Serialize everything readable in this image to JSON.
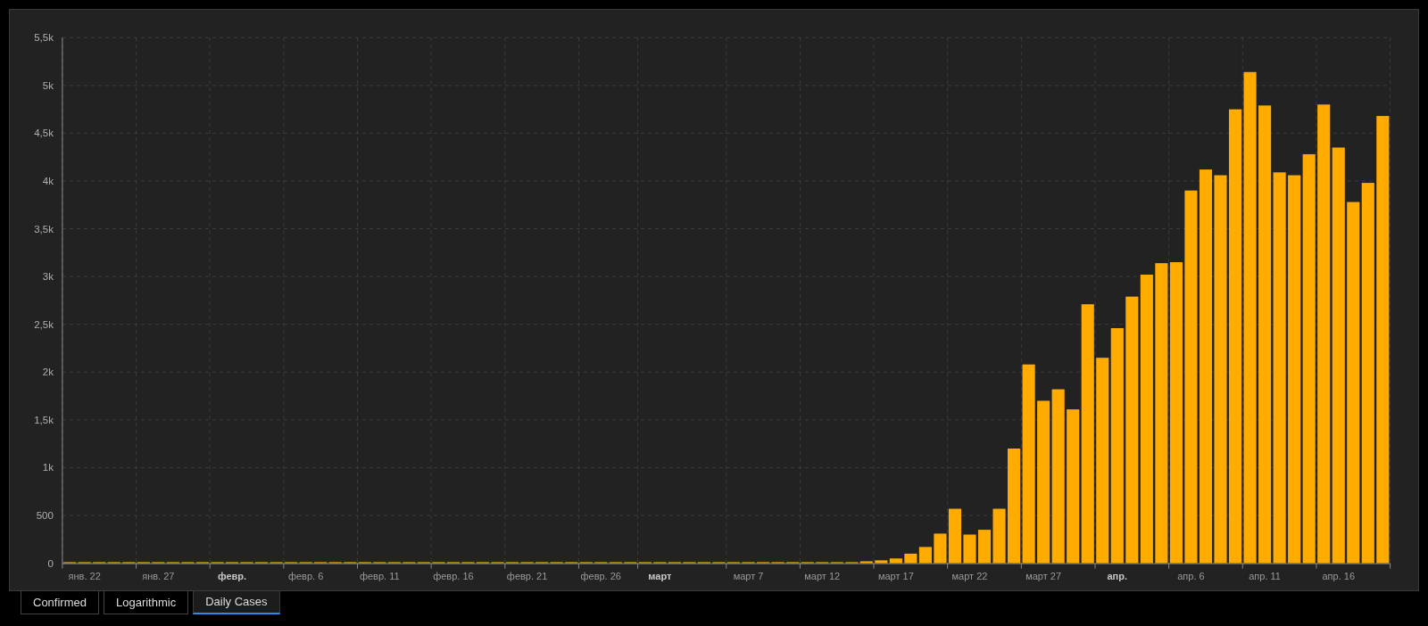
{
  "chart_data": {
    "type": "bar",
    "grid": true,
    "ylim": [
      0,
      5500
    ],
    "yticks": [
      {
        "value": 0,
        "label": "0"
      },
      {
        "value": 500,
        "label": "500"
      },
      {
        "value": 1000,
        "label": "1k"
      },
      {
        "value": 1500,
        "label": "1,5k"
      },
      {
        "value": 2000,
        "label": "2k"
      },
      {
        "value": 2500,
        "label": "2,5k"
      },
      {
        "value": 3000,
        "label": "3k"
      },
      {
        "value": 3500,
        "label": "3,5k"
      },
      {
        "value": 4000,
        "label": "4k"
      },
      {
        "value": 4500,
        "label": "4,5k"
      },
      {
        "value": 5000,
        "label": "5k"
      },
      {
        "value": 5500,
        "label": "5,5k"
      }
    ],
    "categories": [
      null,
      "янв. 22",
      null,
      null,
      null,
      null,
      "янв. 27",
      null,
      null,
      null,
      null,
      "**февр.**",
      null,
      null,
      null,
      null,
      "февр. 6",
      null,
      null,
      null,
      null,
      "февр. 11",
      null,
      null,
      null,
      null,
      "февр. 16",
      null,
      null,
      null,
      null,
      "февр. 21",
      null,
      null,
      null,
      null,
      "февр. 26",
      null,
      null,
      null,
      "**март**",
      null,
      null,
      null,
      null,
      null,
      "март 7",
      null,
      null,
      null,
      null,
      "март 12",
      null,
      null,
      null,
      null,
      "март 17",
      null,
      null,
      null,
      null,
      "март 22",
      null,
      null,
      null,
      null,
      "март 27",
      null,
      null,
      null,
      null,
      "**апр.**",
      null,
      null,
      null,
      null,
      "апр. 6",
      null,
      null,
      null,
      null,
      "апр. 11",
      null,
      null,
      null,
      null,
      "апр. 16",
      null,
      null,
      null
    ],
    "series": [
      {
        "color": "#ffab00",
        "values": [
          0,
          0,
          0,
          0,
          0,
          0,
          0,
          0,
          0,
          0,
          0,
          0,
          0,
          0,
          0,
          0,
          0,
          0,
          0,
          0,
          0,
          0,
          0,
          0,
          0,
          0,
          0,
          0,
          0,
          0,
          0,
          0,
          0,
          0,
          0,
          0,
          0,
          0,
          0,
          0,
          0,
          0,
          0,
          0,
          0,
          0,
          0,
          0,
          0,
          0,
          0,
          0,
          0,
          10,
          20,
          30,
          50,
          100,
          170,
          310,
          570,
          300,
          350,
          570,
          1200,
          2080,
          1700,
          1820,
          1610,
          2710,
          2150,
          2460,
          2790,
          3020,
          3140,
          3150,
          3900,
          4120,
          4060,
          4750,
          5140,
          4790,
          4090,
          4060,
          4280,
          4800,
          4350,
          3780,
          3980,
          4680
        ]
      }
    ]
  },
  "tabs": [
    {
      "label": "Confirmed",
      "selected": false
    },
    {
      "label": "Logarithmic",
      "selected": false
    },
    {
      "label": "Daily Cases",
      "selected": true
    }
  ]
}
